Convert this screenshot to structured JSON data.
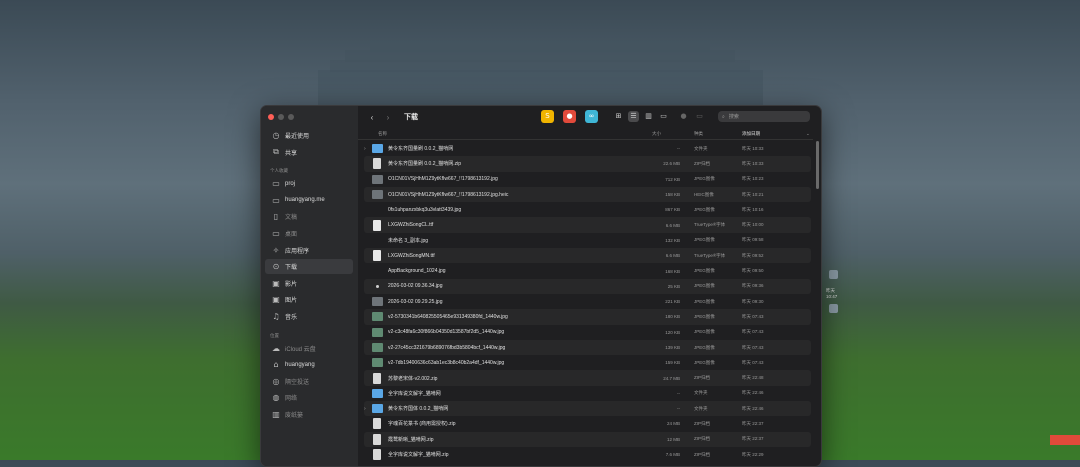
{
  "window": {
    "title": "下载",
    "traffic_colors": [
      "#ff5f57",
      "#febc2e",
      "#28c840"
    ]
  },
  "sidebar": {
    "top_items": [
      {
        "icon": "clock-icon",
        "glyph": "◷",
        "label": "最近使用"
      },
      {
        "icon": "shared-icon",
        "glyph": "⧉",
        "label": "共享"
      }
    ],
    "personal_header": "个人收藏",
    "personal_items": [
      {
        "icon": "folder-icon",
        "glyph": "▭",
        "label": "proj"
      },
      {
        "icon": "folder-icon",
        "glyph": "▭",
        "label": "huangyang.me"
      },
      {
        "icon": "document-icon",
        "glyph": "▯",
        "label": "文稿",
        "dim": true
      },
      {
        "icon": "desktop-icon",
        "glyph": "▭",
        "label": "桌面",
        "dim": true
      },
      {
        "icon": "applications-icon",
        "glyph": "✧",
        "label": "应用程序"
      },
      {
        "icon": "download-icon",
        "glyph": "⊙",
        "label": "下载",
        "selected": true
      },
      {
        "icon": "movies-icon",
        "glyph": "▣",
        "label": "影片"
      },
      {
        "icon": "pictures-icon",
        "glyph": "▣",
        "label": "图片"
      },
      {
        "icon": "music-icon",
        "glyph": "♫",
        "label": "音乐"
      }
    ],
    "location_header": "位置",
    "location_items": [
      {
        "icon": "icloud-icon",
        "glyph": "☁",
        "label": "iCloud 云盘",
        "dim": true
      },
      {
        "icon": "house-icon",
        "glyph": "⌂",
        "label": "huangyang"
      },
      {
        "icon": "network-icon",
        "glyph": "◎",
        "label": "隔空投送",
        "dim": true
      },
      {
        "icon": "globe-icon",
        "glyph": "◍",
        "label": "网络",
        "dim": true
      },
      {
        "icon": "trash-icon",
        "glyph": "▥",
        "label": "废纸篓",
        "dim": true
      }
    ]
  },
  "toolbar": {
    "back": "‹",
    "forward": "›",
    "search_placeholder": "搜索",
    "apps": [
      {
        "name": "app-icon-yellow",
        "glyph": "S",
        "color": "#f0b400"
      },
      {
        "name": "app-icon-red",
        "glyph": "●",
        "color": "#e24a3b"
      },
      {
        "name": "app-icon-teal",
        "glyph": "∞",
        "color": "#3fb6d6"
      }
    ]
  },
  "columns": {
    "name": "名称",
    "size": "大小",
    "kind": "种类",
    "date": "添加日期"
  },
  "files": [
    {
      "name": "黄令东齐国量刷 0.0.2_猫啃网",
      "size": "--",
      "kind": "文件夹",
      "date": "昨天 10:33",
      "type": "folder",
      "chev": "›"
    },
    {
      "name": "黄令东齐国量刷 0.0.2_猫啃网.zip",
      "size": "22.6 MB",
      "kind": "ZIP归档",
      "date": "昨天 10:33",
      "type": "zip"
    },
    {
      "name": "O1CN01VSjHhM1Z9ytKfIw667_!!1798613192.jpg",
      "size": "712 KB",
      "kind": "JPEG图像",
      "date": "昨天 10:23",
      "type": "image"
    },
    {
      "name": "O1CN01VSjHhM1Z9ytKfIw667_!!1798613192.jpg.heic",
      "size": "158 KB",
      "kind": "HEIC图像",
      "date": "昨天 10:21",
      "type": "image"
    },
    {
      "name": "0fs1uhpanzxbkq3u3vlatt3439.jpg",
      "size": "867 KB",
      "kind": "JPEG图像",
      "date": "昨天 10:16",
      "type": "blank"
    },
    {
      "name": "LXGWZhiSongCL.ttf",
      "size": "6.6 MB",
      "kind": "TrueType®字体",
      "date": "昨天 10:00",
      "type": "font"
    },
    {
      "name": "未命名 3_副本.jpg",
      "size": "132 KB",
      "kind": "JPEG图像",
      "date": "昨天 09:58",
      "type": "blank"
    },
    {
      "name": "LXGWZhiSongMN.ttf",
      "size": "6.6 MB",
      "kind": "TrueType®字体",
      "date": "昨天 09:52",
      "type": "font"
    },
    {
      "name": "AppBackground_1024.jpg",
      "size": "168 KB",
      "kind": "JPEG图像",
      "date": "昨天 09:50",
      "type": "blank"
    },
    {
      "name": "2026-03-02 09.36.34.jpg",
      "size": "25 KB",
      "kind": "JPEG图像",
      "date": "昨天 09:36",
      "type": "dot"
    },
    {
      "name": "2026-03-02 09.29.25.jpg",
      "size": "221 KB",
      "kind": "JPEG图像",
      "date": "昨天 09:30",
      "type": "image"
    },
    {
      "name": "v2-5730341b640825505465e931349380fd_1440w.jpg",
      "size": "180 KB",
      "kind": "JPEG图像",
      "date": "昨天 07:43",
      "type": "green"
    },
    {
      "name": "v2-c3c48fa6c30f866b04350d13587bf2d5_1440w.jpg",
      "size": "120 KB",
      "kind": "JPEG图像",
      "date": "昨天 07:43",
      "type": "green"
    },
    {
      "name": "v2-27c45cc321679b689076fbd3b5804bcf_1440w.jpg",
      "size": "139 KB",
      "kind": "JPEG图像",
      "date": "昨天 07:43",
      "type": "green"
    },
    {
      "name": "v2-7db19400636c63ab1ec3b8c40b2a4df_1440w.jpg",
      "size": "159 KB",
      "kind": "JPEG图像",
      "date": "昨天 07:43",
      "type": "green"
    },
    {
      "name": "苏黎老宋体-v2.002.zip",
      "size": "24.7 MB",
      "kind": "ZIP归档",
      "date": "昨天 22:48",
      "type": "zip"
    },
    {
      "name": "全字库说文解字_猫啃网",
      "size": "--",
      "kind": "文件夹",
      "date": "昨天 22:46",
      "type": "folder"
    },
    {
      "name": "黄令东齐国体 0.0.2_猫啃网",
      "size": "--",
      "kind": "文件夹",
      "date": "昨天 22:46",
      "type": "folder",
      "chev": "›"
    },
    {
      "name": "字魂百花篆书 (商用需授权).zip",
      "size": "24 MB",
      "kind": "ZIP归档",
      "date": "昨天 22:37",
      "type": "zip"
    },
    {
      "name": "霞鹜新晰_猫啃网.zip",
      "size": "12 MB",
      "kind": "ZIP归档",
      "date": "昨天 22:37",
      "type": "zip"
    },
    {
      "name": "全字库说文解字_猫啃网.zip",
      "size": "7.6 MB",
      "kind": "ZIP归档",
      "date": "昨天 22:29",
      "type": "zip"
    }
  ],
  "right_float": {
    "label": "昨天 10:47"
  },
  "colors": {
    "folder": "#5aa7e6",
    "selected_row": "#3a3b3e",
    "accent_red": "#e04a3a"
  }
}
